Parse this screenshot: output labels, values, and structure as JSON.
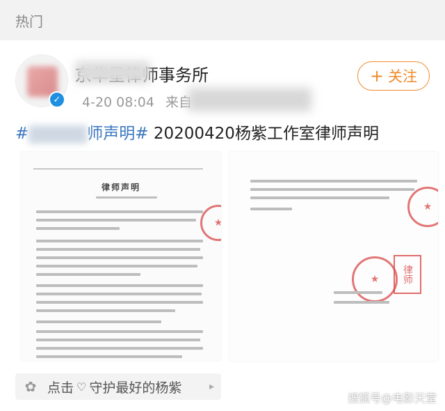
{
  "section": {
    "title": "热门"
  },
  "post": {
    "author_name_visible": "京华星律师事务所",
    "time": "4-20 08:04",
    "source_prefix": "来自",
    "follow_label": "关注",
    "follow_icon": "plus-icon",
    "title_topic_suffix": "师声明#",
    "title_topic_prefix": "#",
    "title_rest": " 20200420杨紫工作室律师声明",
    "documents": {
      "doc1_heading": "律师声明"
    },
    "footer": {
      "text_before": "点击",
      "heart_icon": "heart-outline-icon",
      "text_after": "守护最好的杨紫",
      "flower_icon": "flower-icon"
    }
  },
  "watermark": "搜狐号@电影天堂"
}
